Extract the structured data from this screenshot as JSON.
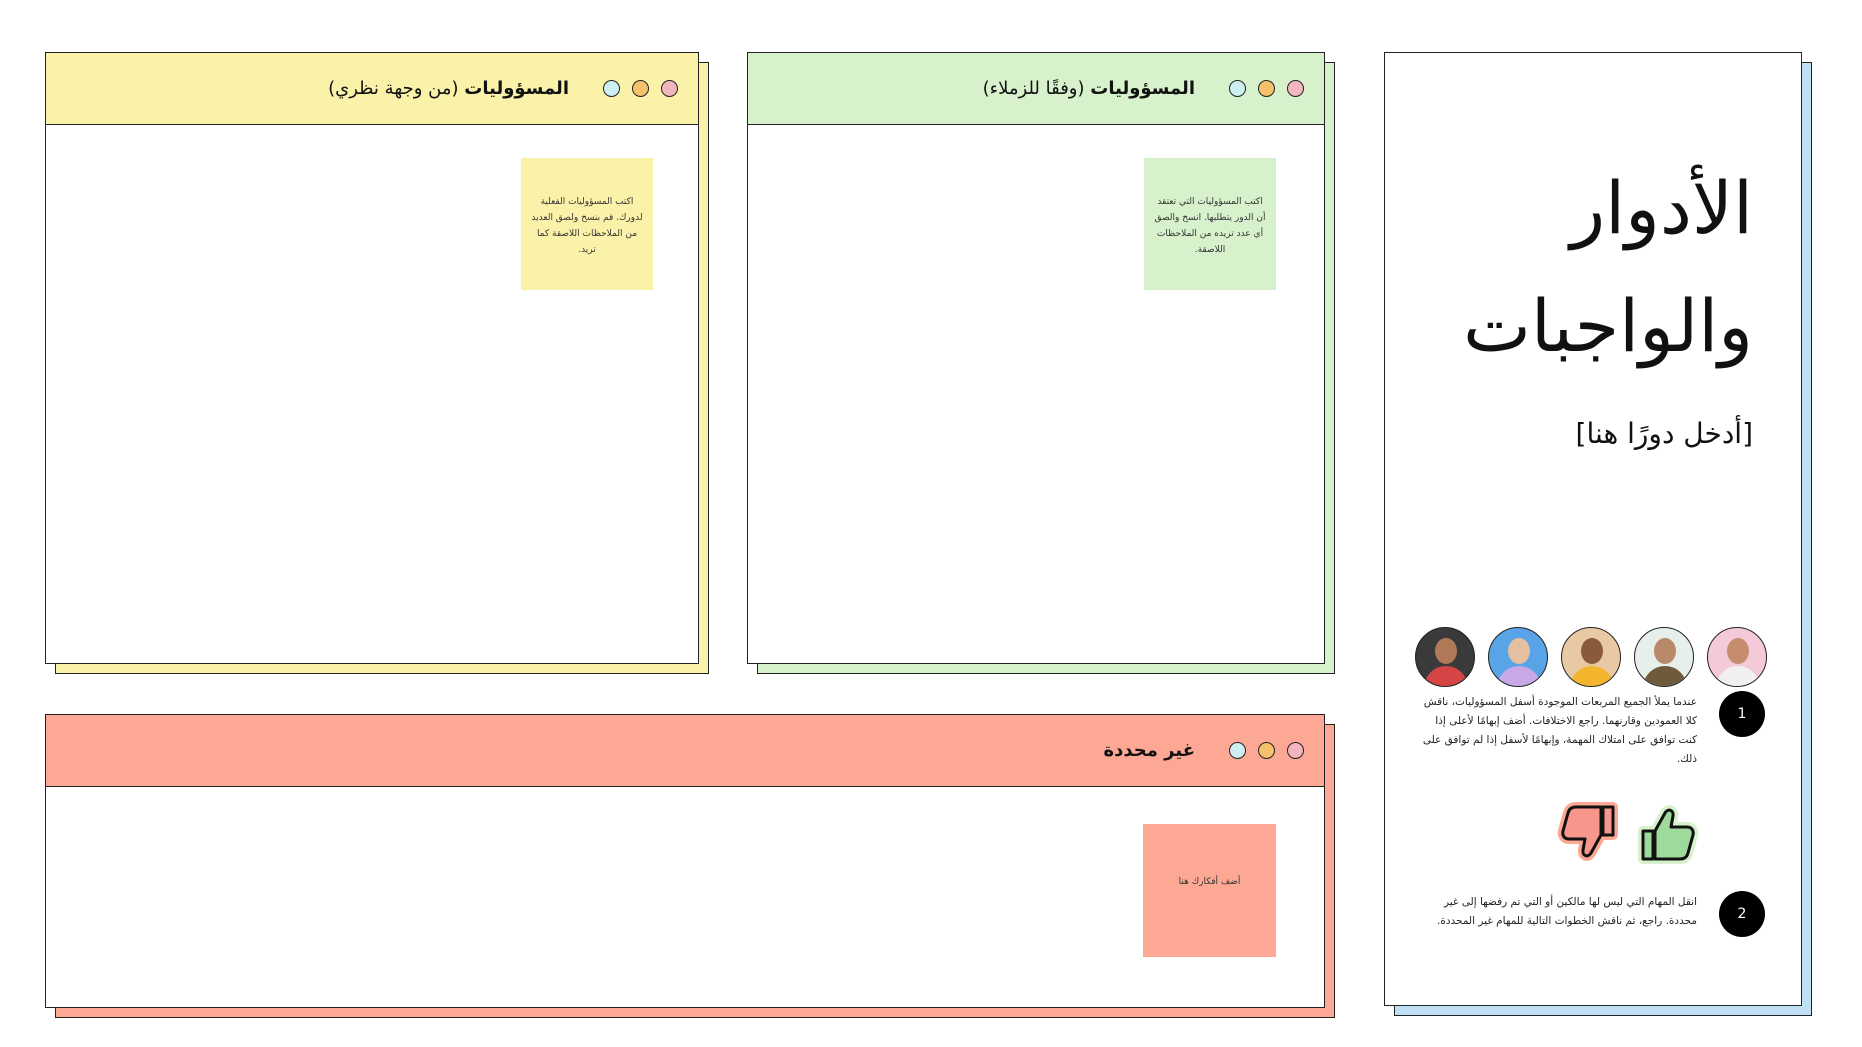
{
  "colors": {
    "yellow": "#FBF2A9",
    "green": "#D6F1CB",
    "salmon": "#FCA894",
    "blue": "#BFE0F4",
    "dot_blue": "#CDEFF1",
    "dot_orange": "#F5C26B",
    "dot_pink": "#F2B6BF"
  },
  "panels": {
    "theory": {
      "title_bold": "المسؤوليات",
      "title_rest": " (من وجهة نظري)",
      "sticky_text": "اكتب المسؤوليات الفعلية لدورك. قم بنسخ ولصق العديد من الملاحظات اللاصقة كما تريد."
    },
    "peers": {
      "title_bold": "المسؤوليات",
      "title_rest": " (وفقًا للزملاء)",
      "sticky_text": "اكتب المسؤوليات التي تعتقد أن الدور يتطلبها. انسخ والصق أي عدد تريده من الملاحظات اللاصقة."
    },
    "undefined": {
      "title": "غير محددة",
      "sticky_text": "أضف أفكارك هنا"
    }
  },
  "card": {
    "title_line1": "الأدوار",
    "title_line2": "والواجبات",
    "subtitle": "[أدخل دورًا هنا]",
    "steps": [
      {
        "number": "1",
        "text": "عندما يملأ الجميع المربعات الموجودة أسفل المسؤوليات، ناقش كلا العمودين وقارنهما. راجع الاختلافات. أضف إبهامًا لأعلى إذا كنت توافق على امتلاك المهمة، وإبهامًا لأسفل إذا لم توافق على ذلك."
      },
      {
        "number": "2",
        "text": "انقل المهام التي ليس لها مالكين أو التي تم رفضها إلى غير محددة. راجع، ثم ناقش الخطوات التالية للمهام غير المحددة."
      }
    ],
    "avatars": [
      "avatar-1",
      "avatar-2",
      "avatar-3",
      "avatar-4",
      "avatar-5"
    ]
  }
}
